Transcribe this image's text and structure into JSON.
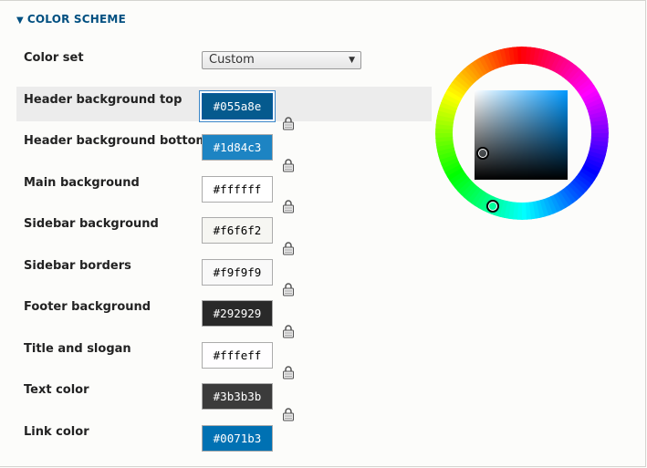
{
  "section": {
    "title": "COLOR SCHEME",
    "icon": "triangle-down-icon"
  },
  "color_set": {
    "label": "Color set",
    "value": "Custom"
  },
  "fields": [
    {
      "label": "Header background top",
      "value": "#055a8e",
      "bg": "#055a8e",
      "fg": "#ffffff"
    },
    {
      "label": "Header background bottom",
      "value": "#1d84c3",
      "bg": "#1d84c3",
      "fg": "#ffffff"
    },
    {
      "label": "Main background",
      "value": "#ffffff",
      "bg": "#ffffff",
      "fg": "#000000"
    },
    {
      "label": "Sidebar background",
      "value": "#f6f6f2",
      "bg": "#f6f6f2",
      "fg": "#000000"
    },
    {
      "label": "Sidebar borders",
      "value": "#f9f9f9",
      "bg": "#f9f9f9",
      "fg": "#000000"
    },
    {
      "label": "Footer background",
      "value": "#292929",
      "bg": "#292929",
      "fg": "#ffffff"
    },
    {
      "label": "Title and slogan",
      "value": "#fffeff",
      "bg": "#fffeff",
      "fg": "#000000"
    },
    {
      "label": "Text color",
      "value": "#3b3b3b",
      "bg": "#3b3b3b",
      "fg": "#ffffff"
    },
    {
      "label": "Link color",
      "value": "#0071b3",
      "bg": "#0071b3",
      "fg": "#ffffff"
    }
  ],
  "active_field": "Header background top",
  "picker": {
    "selected_color": "#055a8e",
    "hue_color": "#0099ff"
  }
}
